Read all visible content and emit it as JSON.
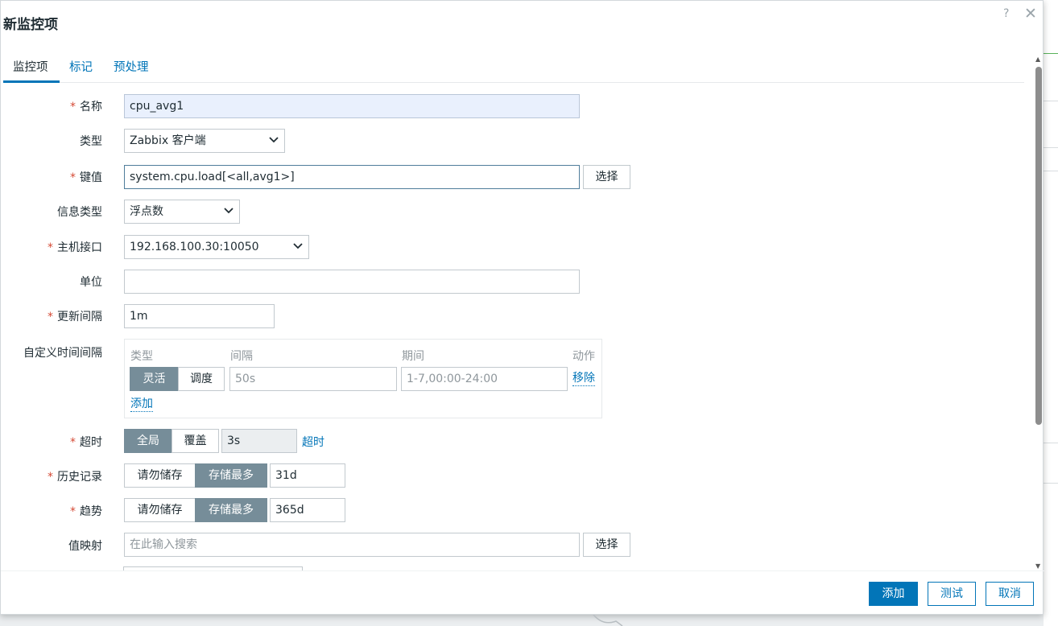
{
  "dialog": {
    "title": "新监控项",
    "help": "?",
    "close": "✕"
  },
  "tabs": [
    {
      "label": "监控项",
      "active": true
    },
    {
      "label": "标记",
      "active": false
    },
    {
      "label": "预处理",
      "active": false
    }
  ],
  "form": {
    "name": {
      "label": "名称",
      "value": "cpu_avg1"
    },
    "type": {
      "label": "类型",
      "value": "Zabbix 客户端"
    },
    "key": {
      "label": "键值",
      "value": "system.cpu.load[<all,avg1>]",
      "select": "选择"
    },
    "info_type": {
      "label": "信息类型",
      "value": "浮点数"
    },
    "host_interface": {
      "label": "主机接口",
      "value": "192.168.100.30:10050"
    },
    "units": {
      "label": "单位",
      "value": ""
    },
    "update_interval": {
      "label": "更新间隔",
      "value": "1m"
    },
    "custom_intervals": {
      "label": "自定义时间间隔",
      "headers": {
        "type": "类型",
        "interval": "间隔",
        "period": "期间",
        "action": "动作"
      },
      "row": {
        "flexible": "灵活",
        "scheduling": "调度",
        "interval_placeholder": "50s",
        "period_placeholder": "1-7,00:00-24:00",
        "remove": "移除"
      },
      "add": "添加"
    },
    "timeout": {
      "label": "超时",
      "global": "全局",
      "override": "覆盖",
      "value": "3s",
      "link": "超时"
    },
    "history": {
      "label": "历史记录",
      "dont_store": "请勿储存",
      "store_up_to": "存储最多",
      "value": "31d"
    },
    "trends": {
      "label": "趋势",
      "dont_store": "请勿储存",
      "store_up_to": "存储最多",
      "value": "365d"
    },
    "value_map": {
      "label": "值映射",
      "placeholder": "在此输入搜索",
      "select": "选择"
    }
  },
  "footer": {
    "add": "添加",
    "test": "测试",
    "cancel": "取消"
  },
  "colors": {
    "accent": "#0275b8",
    "segment_active": "#768d99",
    "required": "#d54a35"
  }
}
